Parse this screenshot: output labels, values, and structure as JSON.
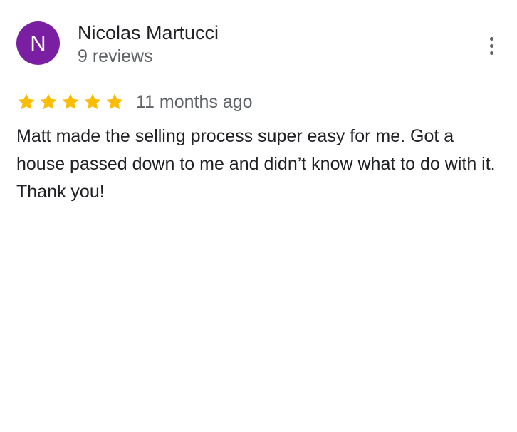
{
  "reviewer": {
    "initial": "N",
    "name": "Nicolas Martucci",
    "review_count": "9 reviews",
    "avatar_color": "#7b1fa2"
  },
  "menu": {
    "icon": "more-vert-icon"
  },
  "review": {
    "rating": 5,
    "max_rating": 5,
    "star_color": "#fbbc04",
    "date": "11 months ago",
    "text": "Matt made the selling process super easy for me. Got a house passed down to me and didn’t know what to do with it. Thank you!"
  }
}
